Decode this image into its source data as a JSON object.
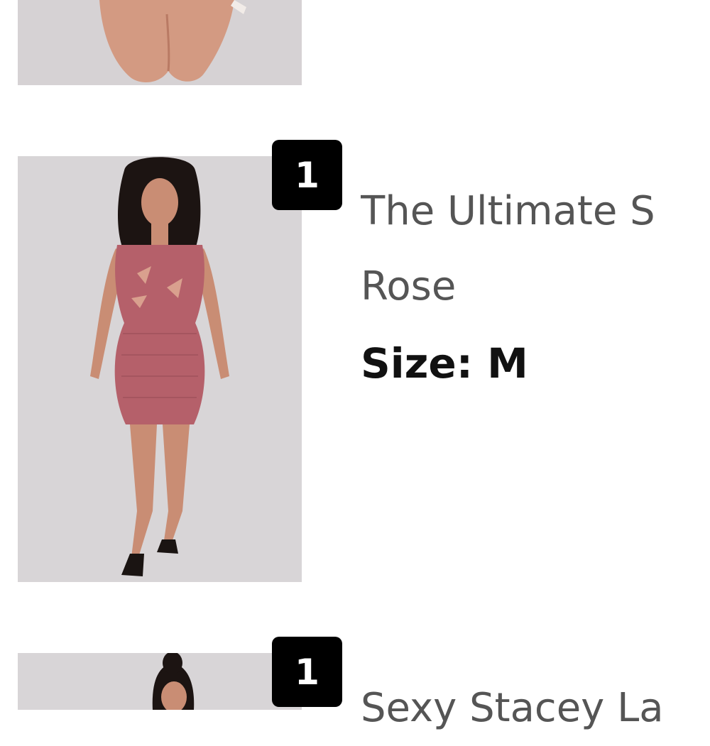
{
  "cart": {
    "items": [
      {
        "image": "product-photo-legs",
        "quantity": "",
        "name_line1": "",
        "name_line2": "",
        "size_label": "",
        "size_value": ""
      },
      {
        "image": "product-photo-rose-bandage-dress",
        "quantity": "1",
        "name_line1": "The Ultimate S",
        "name_line2": "Rose",
        "size_label": "Size:",
        "size_value": "M"
      },
      {
        "image": "product-photo-model",
        "quantity": "1",
        "name_line1": "Sexy Stacey La",
        "name_line2": "",
        "size_label": "",
        "size_value": ""
      }
    ]
  },
  "colors": {
    "badge_bg": "#000000",
    "dress": "#b5606a",
    "photo_bg": "#d8d5d7"
  }
}
